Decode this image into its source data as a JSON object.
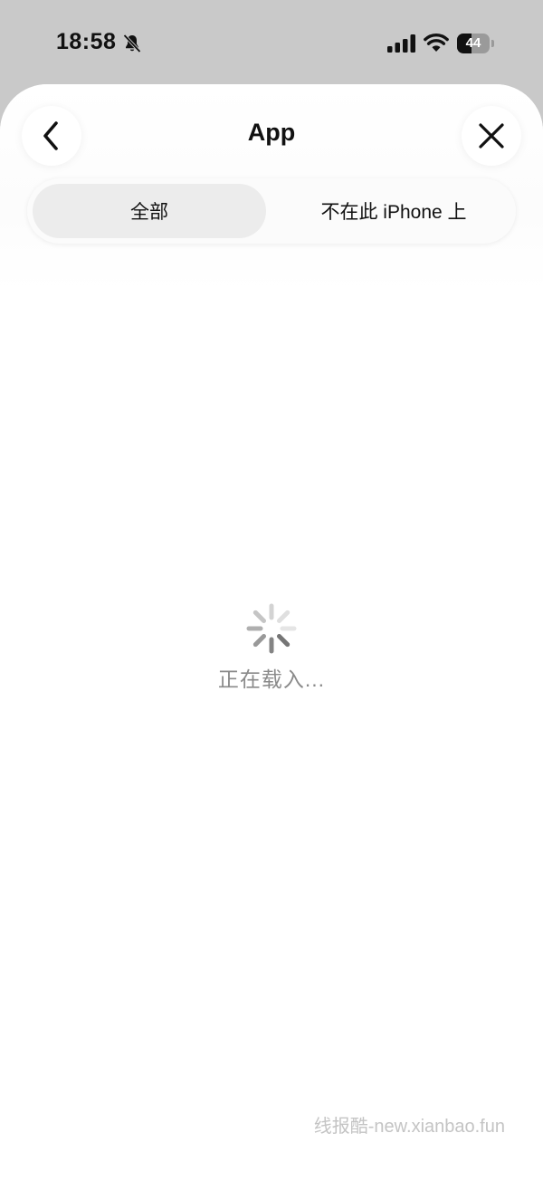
{
  "status_bar": {
    "time": "18:58",
    "battery_level": "44",
    "battery_fraction": 0.44,
    "icons": [
      "bell-muted-icon",
      "cellular-signal-icon",
      "wifi-icon",
      "battery-icon"
    ]
  },
  "header": {
    "title": "App",
    "back_icon": "chevron-left-icon",
    "close_icon": "close-icon"
  },
  "tabs": [
    {
      "label": "全部",
      "selected": true
    },
    {
      "label": "不在此 iPhone 上",
      "selected": false
    }
  ],
  "loading": {
    "text": "正在载入...",
    "icon": "spinner-icon"
  },
  "watermark": "线报酷-new.xianbao.fun",
  "colors": {
    "background_dim": "#c9c9c9",
    "sheet": "#ffffff",
    "selected_tab": "#ececec",
    "loading_text": "#8a8a8a",
    "watermark": "#c4c4c4"
  }
}
